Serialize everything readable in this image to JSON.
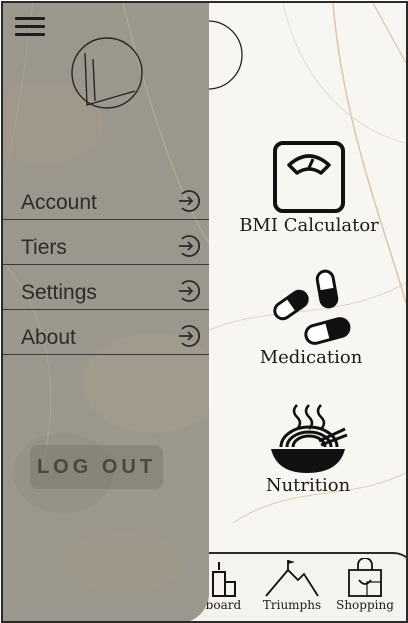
{
  "drawer": {
    "menu_items": [
      {
        "label": "Account",
        "icon": "arrow-right-circle-icon"
      },
      {
        "label": "Tiers",
        "icon": "arrow-right-circle-icon"
      },
      {
        "label": "Settings",
        "icon": "arrow-right-circle-icon"
      },
      {
        "label": "About",
        "icon": "arrow-right-circle-icon"
      }
    ],
    "logout_label": "LOG OUT"
  },
  "main": {
    "tiles": [
      {
        "label": "BMI Calculator",
        "icon": "scale-icon"
      },
      {
        "label": "Medication",
        "icon": "pills-icon"
      },
      {
        "label": "Nutrition",
        "icon": "noodle-bowl-icon"
      }
    ]
  },
  "bottom_nav": {
    "items": [
      {
        "label": "erboard",
        "icon": "podium-icon"
      },
      {
        "label": "Triumphs",
        "icon": "mountain-flag-icon"
      },
      {
        "label": "Shopping",
        "icon": "shopping-bag-icon"
      }
    ]
  },
  "colors": {
    "drawer_bg": "#9a968c",
    "main_bg": "#f7f6f2",
    "ink": "#1a1a1a"
  }
}
